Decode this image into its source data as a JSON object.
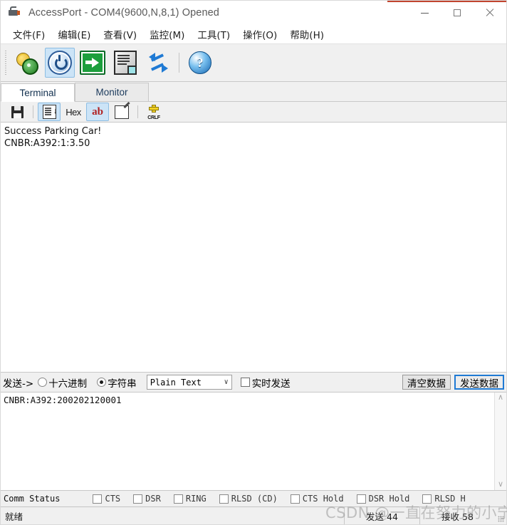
{
  "window": {
    "title": "AccessPort - COM4(9600,N,8,1) Opened",
    "icon": "serial-plug-icon",
    "minimize": "—",
    "maximize": "☐",
    "close": "✕",
    "accent_red": "#c1442e"
  },
  "menubar": {
    "items": [
      {
        "label": "文件(F)"
      },
      {
        "label": "编辑(E)"
      },
      {
        "label": "查看(V)"
      },
      {
        "label": "监控(M)"
      },
      {
        "label": "工具(T)"
      },
      {
        "label": "操作(O)"
      },
      {
        "label": "帮助(H)"
      }
    ]
  },
  "toolbar": {
    "buttons": [
      {
        "icon": "settings-gears-icon",
        "active": false
      },
      {
        "icon": "power-toggle-icon",
        "active": true
      },
      {
        "icon": "green-arrow-send-icon",
        "active": false
      },
      {
        "icon": "document-icon",
        "active": false
      },
      {
        "icon": "refresh-arrows-icon",
        "active": false
      },
      {
        "icon": "help-question-icon",
        "active": false
      }
    ],
    "help_glyph": "?"
  },
  "tabs": {
    "items": [
      {
        "label": "Terminal",
        "selected": true
      },
      {
        "label": "Monitor",
        "selected": false
      }
    ]
  },
  "subtoolbar": {
    "buttons": [
      {
        "icon": "save-disk-icon",
        "active": false
      },
      {
        "icon": "list-scroll-icon",
        "active": true
      },
      {
        "icon": "hex-view-icon",
        "label": "Hex",
        "active": false
      },
      {
        "icon": "ascii-view-icon",
        "label": "ab",
        "active": true
      },
      {
        "icon": "edit-pencil-icon",
        "active": false
      },
      {
        "icon": "crlf-icon",
        "label": "CRLF",
        "active": false
      }
    ]
  },
  "terminal": {
    "lines": [
      "Success Parking Car!",
      "CNBR:A392:1:3.50"
    ],
    "line1": "Success Parking Car!",
    "line2": "CNBR:A392:1:3.50"
  },
  "sendbar": {
    "label": "发送->",
    "radio_hex": "十六进制",
    "radio_string": "字符串",
    "radio_selected": "string",
    "format_value": "Plain Text",
    "format_options": [
      "Plain Text"
    ],
    "chevron": "∨",
    "realtime_label": "实时发送",
    "realtime_checked": false,
    "clear_button": "清空数据",
    "send_button": "发送数据",
    "send_button_focus_color": "#1f7ad4"
  },
  "sendinput": {
    "value": "CNBR:A392:200202120001",
    "scroll_up": "∧",
    "scroll_down": "∨"
  },
  "commstatus": {
    "title": "Comm Status",
    "items": [
      {
        "label": "CTS",
        "checked": false
      },
      {
        "label": "DSR",
        "checked": false
      },
      {
        "label": "RING",
        "checked": false
      },
      {
        "label": "RLSD (CD)",
        "checked": false
      },
      {
        "label": "CTS Hold",
        "checked": false
      },
      {
        "label": "DSR Hold",
        "checked": false
      },
      {
        "label": "RLSD H",
        "checked": false
      }
    ]
  },
  "statusbar": {
    "ready": "就绪",
    "sent": "发送 44",
    "received": "接收 58"
  },
  "watermark": {
    "text": "CSDN @一直在努力的小宁"
  }
}
